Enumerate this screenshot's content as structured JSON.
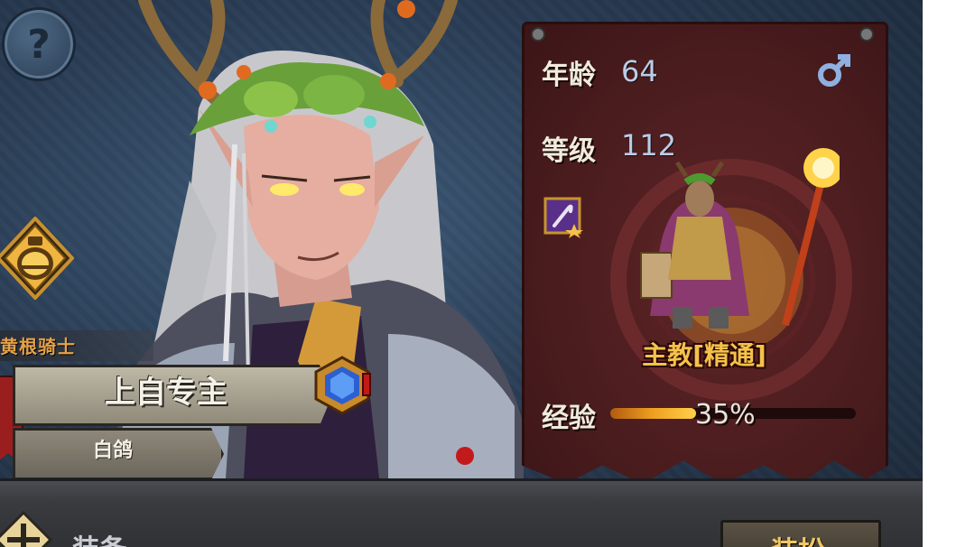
{
  "character": {
    "title": "黄根骑士",
    "name": "上自专主",
    "subtitle": "白鸽"
  },
  "stats": {
    "age_label": "年龄",
    "age_value": "64",
    "level_label": "等级",
    "level_value": "112",
    "exp_label": "经验",
    "exp_value": "35%",
    "exp_fraction": 0.35
  },
  "class": {
    "name": "主教[精通]"
  },
  "bottom": {
    "section_label": "装备",
    "button_label": "装扮"
  },
  "icons": {
    "help": "question-mark-icon",
    "potion": "potion-icon",
    "gender": "male-symbol-icon",
    "skill": "staff-skill-icon",
    "expand": "plus-icon"
  },
  "colors": {
    "panel": "#4a1c1e",
    "accent_gold": "#f5c24a",
    "value_blue": "#b9cde8"
  }
}
